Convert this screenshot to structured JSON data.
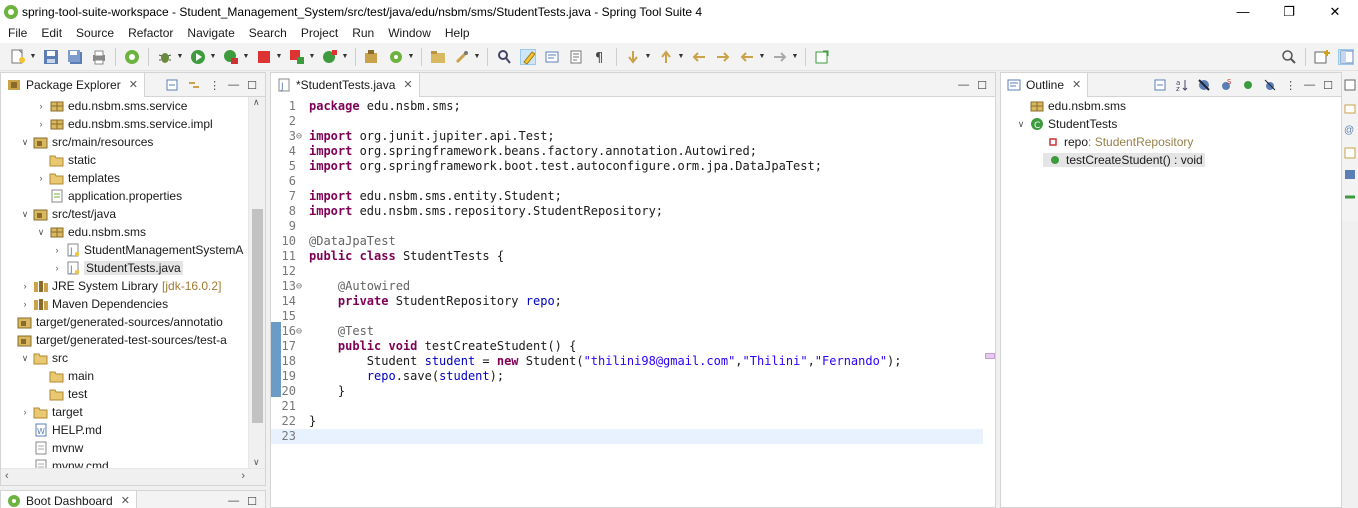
{
  "window": {
    "title": "spring-tool-suite-workspace - Student_Management_System/src/test/java/edu/nsbm/sms/StudentTests.java - Spring Tool Suite 4",
    "minimize": "—",
    "restore": "❐",
    "close": "✕"
  },
  "menu": [
    "File",
    "Edit",
    "Source",
    "Refactor",
    "Navigate",
    "Search",
    "Project",
    "Run",
    "Window",
    "Help"
  ],
  "package_explorer": {
    "tab_label": "Package Explorer",
    "items": [
      {
        "label": "edu.nsbm.sms.service",
        "icon": "package-icon",
        "expanded": false
      },
      {
        "label": "edu.nsbm.sms.service.impl",
        "icon": "package-icon",
        "expanded": false
      },
      {
        "label": "src/main/resources",
        "icon": "source-folder-icon",
        "expanded": true
      },
      {
        "label": "static",
        "icon": "folder-icon",
        "expanded": null
      },
      {
        "label": "templates",
        "icon": "folder-icon",
        "expanded": false
      },
      {
        "label": "application.properties",
        "icon": "properties-file-icon",
        "expanded": null
      },
      {
        "label": "src/test/java",
        "icon": "source-folder-icon",
        "expanded": true
      },
      {
        "label": "edu.nsbm.sms",
        "icon": "package-icon",
        "expanded": true
      },
      {
        "label": "StudentManagementSystemA",
        "icon": "java-file-icon",
        "expanded": false
      },
      {
        "label": "StudentTests.java",
        "icon": "java-file-icon",
        "expanded": false,
        "selected": true
      },
      {
        "label": "JRE System Library",
        "decoration": "[jdk-16.0.2]",
        "icon": "library-icon",
        "expanded": false
      },
      {
        "label": "Maven Dependencies",
        "icon": "library-icon",
        "expanded": false
      },
      {
        "label": "target/generated-sources/annotatio",
        "icon": "source-folder-icon",
        "expanded": null
      },
      {
        "label": "target/generated-test-sources/test-a",
        "icon": "source-folder-icon",
        "expanded": null
      },
      {
        "label": "src",
        "icon": "folder-icon",
        "expanded": true
      },
      {
        "label": "main",
        "icon": "folder-icon",
        "expanded": null
      },
      {
        "label": "test",
        "icon": "folder-icon",
        "expanded": null
      },
      {
        "label": "target",
        "icon": "folder-icon",
        "expanded": false
      },
      {
        "label": "HELP.md",
        "icon": "md-file-icon",
        "expanded": null
      },
      {
        "label": "mvnw",
        "icon": "file-icon",
        "expanded": null
      },
      {
        "label": "mvnw.cmd",
        "icon": "file-icon",
        "expanded": null
      }
    ]
  },
  "boot_dashboard": {
    "tab_label": "Boot Dashboard"
  },
  "editor": {
    "tab_label": "*StudentTests.java",
    "lines": [
      {
        "n": "1",
        "fold": "",
        "tokens": [
          [
            "kw",
            "package"
          ],
          [
            "t",
            " edu.nsbm.sms;"
          ]
        ]
      },
      {
        "n": "2",
        "fold": "",
        "tokens": []
      },
      {
        "n": "3",
        "fold": "⊖",
        "tokens": [
          [
            "kw",
            "import"
          ],
          [
            "t",
            " org.junit.jupiter.api.Test;"
          ]
        ]
      },
      {
        "n": "4",
        "fold": "",
        "tokens": [
          [
            "kw",
            "import"
          ],
          [
            "t",
            " org.springframework.beans.factory.annotation.Autowired;"
          ]
        ]
      },
      {
        "n": "5",
        "fold": "",
        "tokens": [
          [
            "kw",
            "import"
          ],
          [
            "t",
            " org.springframework.boot.test.autoconfigure.orm.jpa.DataJpaTest;"
          ]
        ]
      },
      {
        "n": "6",
        "fold": "",
        "tokens": []
      },
      {
        "n": "7",
        "fold": "",
        "tokens": [
          [
            "kw",
            "import"
          ],
          [
            "t",
            " edu.nsbm.sms.entity.Student;"
          ]
        ]
      },
      {
        "n": "8",
        "fold": "",
        "tokens": [
          [
            "kw",
            "import"
          ],
          [
            "t",
            " edu.nsbm.sms.repository.StudentRepository;"
          ]
        ]
      },
      {
        "n": "9",
        "fold": "",
        "tokens": []
      },
      {
        "n": "10",
        "fold": "",
        "tokens": [
          [
            "ann",
            "@DataJpaTest"
          ]
        ]
      },
      {
        "n": "11",
        "fold": "",
        "tokens": [
          [
            "kw",
            "public"
          ],
          [
            "t",
            " "
          ],
          [
            "kw",
            "class"
          ],
          [
            "t",
            " StudentTests {"
          ]
        ]
      },
      {
        "n": "12",
        "fold": "",
        "tokens": []
      },
      {
        "n": "13",
        "fold": "⊖",
        "tokens": [
          [
            "t",
            "    "
          ],
          [
            "ann",
            "@Autowired"
          ]
        ]
      },
      {
        "n": "14",
        "fold": "",
        "tokens": [
          [
            "t",
            "    "
          ],
          [
            "kw",
            "private"
          ],
          [
            "t",
            " StudentRepository "
          ],
          [
            "fld",
            "repo"
          ],
          [
            "t",
            ";"
          ]
        ]
      },
      {
        "n": "15",
        "fold": "",
        "tokens": []
      },
      {
        "n": "16",
        "fold": "⊖",
        "tokens": [
          [
            "t",
            "    "
          ],
          [
            "ann",
            "@Test"
          ]
        ]
      },
      {
        "n": "17",
        "fold": "",
        "tokens": [
          [
            "t",
            "    "
          ],
          [
            "kw",
            "public"
          ],
          [
            "t",
            " "
          ],
          [
            "kw",
            "void"
          ],
          [
            "t",
            " testCreateStudent() {"
          ]
        ]
      },
      {
        "n": "18",
        "fold": "",
        "tokens": [
          [
            "t",
            "        Student "
          ],
          [
            "fld",
            "student"
          ],
          [
            "t",
            " = "
          ],
          [
            "kw",
            "new"
          ],
          [
            "t",
            " Student("
          ],
          [
            "str",
            "\"thilini98@gmail.com\""
          ],
          [
            "t",
            ","
          ],
          [
            "str",
            "\"Thilini\""
          ],
          [
            "t",
            ","
          ],
          [
            "str",
            "\"Fernando\""
          ],
          [
            "t",
            ");"
          ]
        ]
      },
      {
        "n": "19",
        "fold": "",
        "tokens": [
          [
            "t",
            "        "
          ],
          [
            "fld",
            "repo"
          ],
          [
            "t",
            ".save("
          ],
          [
            "fld",
            "student"
          ],
          [
            "t",
            ");"
          ]
        ]
      },
      {
        "n": "20",
        "fold": "",
        "tokens": [
          [
            "t",
            "    }"
          ]
        ]
      },
      {
        "n": "21",
        "fold": "",
        "tokens": []
      },
      {
        "n": "22",
        "fold": "",
        "tokens": [
          [
            "t",
            "}"
          ]
        ]
      },
      {
        "n": "23",
        "fold": "",
        "tokens": []
      }
    ]
  },
  "outline": {
    "tab_label": "Outline",
    "items": [
      {
        "label": "edu.nsbm.sms",
        "type": "",
        "icon": "package-icon"
      },
      {
        "label": "StudentTests",
        "type": "",
        "icon": "class-icon"
      },
      {
        "label": "repo",
        "type": " : StudentRepository",
        "icon": "private-field-icon"
      },
      {
        "label": "testCreateStudent() : void",
        "type": "",
        "icon": "public-method-icon",
        "selected": true
      }
    ]
  },
  "colors": {
    "keyword": "#7f0055",
    "string": "#2a00ff",
    "annotation": "#646464",
    "field": "#0000c0",
    "current_line": "#e8f2fe"
  }
}
